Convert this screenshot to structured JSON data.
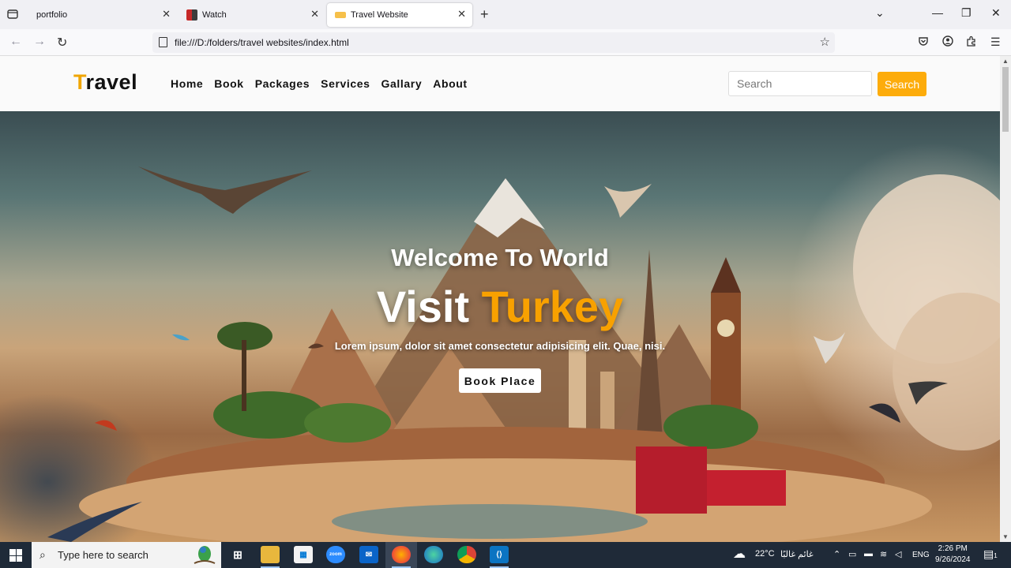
{
  "browser": {
    "tabs": [
      {
        "label": "portfolio",
        "active": false
      },
      {
        "label": "Watch",
        "active": false
      },
      {
        "label": "Travel Website",
        "active": true
      }
    ],
    "url": "file:///D:/folders/travel websites/index.html"
  },
  "site": {
    "logo_first": "T",
    "logo_rest": "ravel",
    "menu": [
      "Home",
      "Book",
      "Packages",
      "Services",
      "Gallary",
      "About"
    ],
    "search_placeholder": "Search",
    "search_button": "Search"
  },
  "hero": {
    "welcome": "Welcome To World",
    "visit": "Visit",
    "destination": "Turkey",
    "lorem": "Lorem ipsum, dolor sit amet consectetur adipisicing elit. Quae, nisi.",
    "book_button": "Book Place"
  },
  "taskbar": {
    "search_placeholder": "Type here to search",
    "weather": "22°C",
    "weather_desc": "غائم غالبًا",
    "lang": "ENG",
    "time": "2:26 PM",
    "date": "9/26/2024",
    "notification_count": "1"
  },
  "colors": {
    "accent": "#f8a100",
    "search_button": "#fdac0b"
  }
}
